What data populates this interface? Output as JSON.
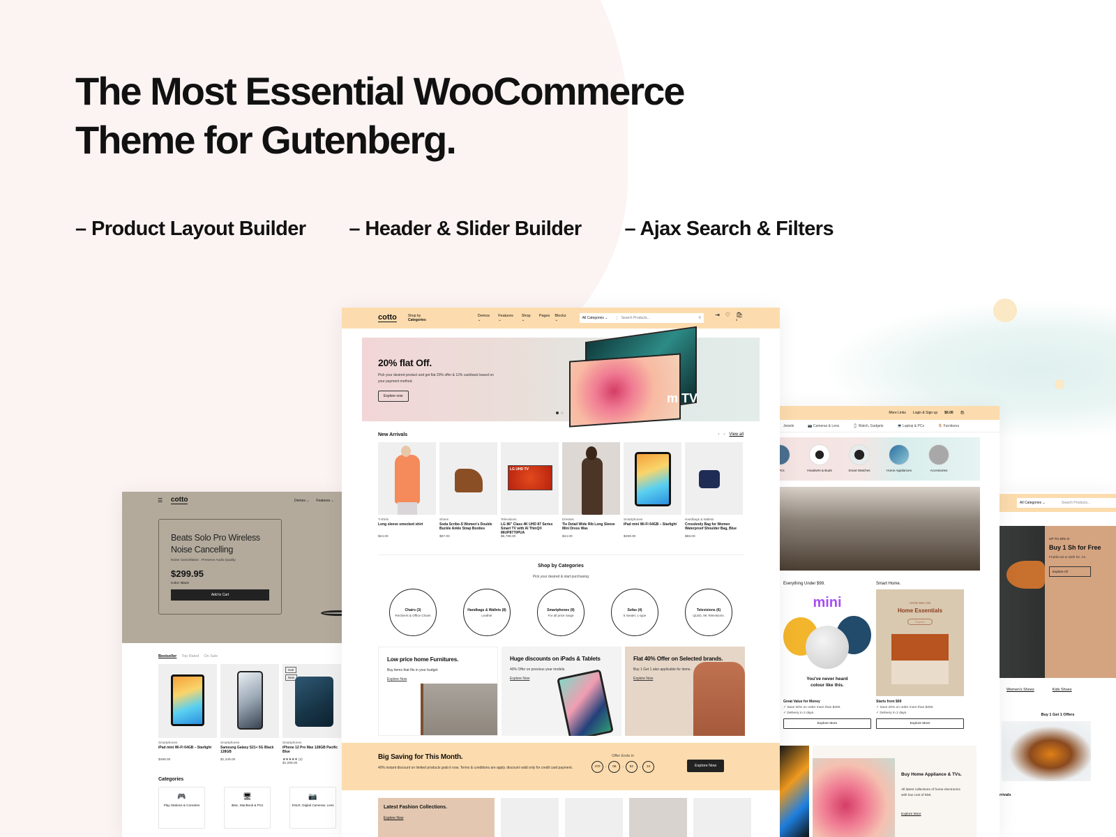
{
  "hero": {
    "title_line1": "The Most Essential WooCommerce",
    "title_line2": "Theme for Gutenberg.",
    "features": [
      "– Product Layout Builder",
      "– Header & Slider Builder",
      "– Ajax Search & Filters"
    ]
  },
  "colors": {
    "header_bg": "#fcdcae",
    "accent_dark": "#222222",
    "left_hero_bg": "#b3aa9c"
  },
  "mid": {
    "header": {
      "logo": "cotto",
      "shop_by_1": "Shop by",
      "shop_by_2": "Categories",
      "nav": [
        "Demos ⌄",
        "Features ⌄",
        "Shop ⌄",
        "Pages",
        "Blocks ⌄"
      ],
      "category_select": "All Categories ⌄",
      "search_placeholder": "Search Products...",
      "cart_count": "0"
    },
    "slider": {
      "title": "20% flat Off.",
      "text": "Pick your desired product and get flat 20% offer & 12% cashback based on your payment method.",
      "button": "Explore now",
      "tv_text": "m TV"
    },
    "new_arrivals": {
      "title": "New Arrivals",
      "view_all": "View all",
      "products": [
        {
          "category": "T-shirts",
          "name": "Long sleeve smocked shirt",
          "price": "$24.00"
        },
        {
          "category": "Shoes",
          "name": "Soda Scribe-S Women's Double Buckle Ankle Strap Booties",
          "price": "$57.00"
        },
        {
          "category": "Televisions",
          "name": "LG 86\" Class 4K UHD 87 Series Smart TV with AI ThinQ® 86UP8770PUA",
          "price": "$6,788.00"
        },
        {
          "category": "Dresses",
          "name": "Tie Detail Wide Rib Long Sleeve Mini Dress Was",
          "price": "$44.00"
        },
        {
          "category": "Smartphones",
          "name": "iPad mini Wi-Fi 64GB – Starlight",
          "price": "$499.00"
        },
        {
          "category": "Handbags & Wallets",
          "name": "Crossbody Bag for Women Waterproof Shoulder Bag, Blue",
          "price": "$59.00"
        }
      ]
    },
    "shop_by_categories": {
      "title": "Shop by Categories",
      "subtitle": "Pick your desired & start purchasing",
      "items": [
        {
          "name": "Chairs (3)",
          "desc": "Recliners & Office Chairs"
        },
        {
          "name": "Handbags & Wallets (8)",
          "desc": "Leather"
        },
        {
          "name": "Smartphones (9)",
          "desc": "For all price range"
        },
        {
          "name": "Sofas (4)",
          "desc": "5 Seater, L-type"
        },
        {
          "name": "Televisions (6)",
          "desc": "QLED, 8K Televisions."
        }
      ]
    },
    "promos": [
      {
        "title": "Low price home Furnitures.",
        "text": "Buy items that fits in your budget",
        "link": "Explore Now"
      },
      {
        "title": "Huge discounts on iPads & Tablets",
        "text": "40% Offer on previous year models.",
        "link": "Explore Now"
      },
      {
        "title": "Flat 40% Offer on Selected brands.",
        "text": "Buy 1 Get 1 also applicable for items.",
        "link": "Explore Now"
      }
    ],
    "big_saving": {
      "title": "Big Saving for This Month.",
      "text": "40% instant discount on limited products grab it now. Terms & conditions are apply. discount valid only for credit card payment.",
      "countdown_label": "Offer Ends in",
      "countdown": [
        "470",
        "06",
        "52",
        "24"
      ],
      "button": "Explore Now"
    },
    "lower": {
      "title": "Latest Fashion Collections.",
      "link": "Explore Now"
    }
  },
  "left": {
    "logo": "cotto",
    "nav": [
      "Demos ⌄",
      "Features ⌄"
    ],
    "hero": {
      "title": "Beats Solo Pro Wireless Noise Cancelling",
      "subtitle": "Noise Cancellation . Preserve Audio Quality",
      "price": "$299.95",
      "color": "Color: Black",
      "button": "Add to Cart"
    },
    "tabs": [
      "Bestseller",
      "Top Rated",
      "On Sale"
    ],
    "products": [
      {
        "category": "Smartphones",
        "name": "iPad mini Wi-Fi 64GB – Starlight",
        "price": "$499.00"
      },
      {
        "category": "Smartphones",
        "name": "Samsung Galaxy S21+ 5G Black 128GB",
        "price": "$1,349.00"
      },
      {
        "category": "Smartphones",
        "name": "iPhone 12 Pro Max 128GB Pacific Blue",
        "rating": "★★★★★ (3)",
        "price": "$1,099.00",
        "badges": [
          "Hot!",
          "New"
        ]
      }
    ],
    "categories_title": "Categories",
    "categories": [
      {
        "icon": "gamepad-icon",
        "glyph": "🎮",
        "label": "Play Stations & Consoles"
      },
      {
        "icon": "monitor-icon",
        "glyph": "🖥",
        "label": "iMac, MacBook & PCs"
      },
      {
        "icon": "camera-icon",
        "glyph": "📷",
        "label": "DSLR, Digital Cameras, Lens"
      }
    ]
  },
  "right": {
    "top_links": [
      "More Links",
      "Login & Sign up",
      "$0.00"
    ],
    "cart_count": "0",
    "cat_bar": [
      "Jewels",
      "Cameras & Lens",
      "Watch, Gadgets",
      "Laptop & PCs",
      "Furnitures"
    ],
    "icon_cats": [
      "& PCs",
      "Headsets & Buds",
      "Smart Watches",
      "Home Appliances",
      "Accessories"
    ],
    "col1": {
      "title": "Everything Under $99.",
      "img_word": "mini",
      "img_tag": "You've never heard colour like this.",
      "sub": "Great Value for Money",
      "points": [
        "✓ Save 20% on order more than $200.",
        "✓ Delivery in 2 days."
      ],
      "button": "Explore More"
    },
    "col2": {
      "title": "Smart Home.",
      "img_kicker": "SAVE BIG ON",
      "img_title": "Home Essentials",
      "img_btn": "Explore",
      "sub": "Starts from $69",
      "points": [
        "✓ Save 20% on order more than $200.",
        "✓ Delivery in 2 days."
      ],
      "button": "Explore More"
    },
    "bottom": {
      "title": "Buy Home Appliance & TVs.",
      "text": "All latest collections of home electronics with low cost of EMI.",
      "link": "Explore More"
    }
  },
  "far": {
    "category_select": "All Categories ⌄",
    "search_placeholder": "Search Products...",
    "hero": {
      "kicker": "UP TO 40% O",
      "title": "Buy 1 Sh for Free",
      "text": "Fruitful air w sixth he. An",
      "button": "Explore All"
    },
    "links": [
      "Women's Shoes",
      "Kids Shoes"
    ],
    "offer_title": "Buy 1 Get 1 Offers",
    "arrivals": "rrivals"
  }
}
